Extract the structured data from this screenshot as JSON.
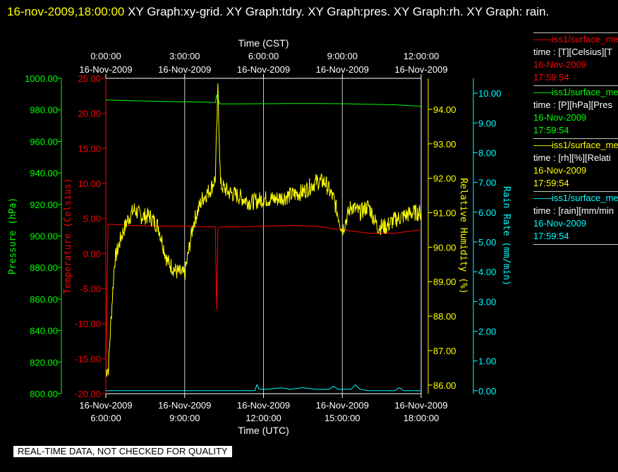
{
  "header": {
    "timestamp": "16-nov-2009,18:00:00",
    "graph_titles": "XY Graph:xy-grid.  XY Graph:tdry.  XY Graph:pres.  XY Graph:rh.  XY Graph: rain."
  },
  "colors": {
    "background": "#000000",
    "pressure": "#00ff00",
    "temperature": "#ff0000",
    "humidity": "#ffff00",
    "rain": "#00ffff",
    "axis": "#ffffff"
  },
  "legend": [
    {
      "series": "——iss1/surface_me",
      "units": "time : [T][Celsius][T",
      "date": "16-Nov-2009",
      "time": "17:59:54",
      "color": "#ff0000"
    },
    {
      "series": "——iss1/surface_me",
      "units": "time : [P][hPa][Pres",
      "date": "16-Nov-2009",
      "time": "17:59:54",
      "color": "#00ff00"
    },
    {
      "series": "——iss1/surface_me",
      "units": "time : [rh][%][Relati",
      "date": "16-Nov-2009",
      "time": "17:59:54",
      "color": "#ffff00"
    },
    {
      "series": "——iss1/surface_me",
      "units": "time : [rain][mm/min",
      "date": "16-Nov-2009",
      "time": "17:59:54",
      "color": "#00ffff"
    }
  ],
  "qc_banner": "REAL-TIME DATA, NOT CHECKED FOR QUALITY",
  "chart_data": {
    "type": "line",
    "grid": "vertical",
    "x_top": {
      "label": "Time (CST)",
      "ticks": [
        {
          "time": "0:00:00",
          "date": "16-Nov-2009"
        },
        {
          "time": "3:00:00",
          "date": "16-Nov-2009"
        },
        {
          "time": "6:00:00",
          "date": "16-Nov-2009"
        },
        {
          "time": "9:00:00",
          "date": "16-Nov-2009"
        },
        {
          "time": "12:00:00",
          "date": "16-Nov-2009"
        }
      ]
    },
    "x_bottom": {
      "label": "Time (UTC)",
      "range": [
        "16-Nov-2009 6:00:00",
        "16-Nov-2009 18:00:00"
      ],
      "ticks": [
        {
          "time": "6:00:00",
          "date": "16-Nov-2009"
        },
        {
          "time": "9:00:00",
          "date": "16-Nov-2009"
        },
        {
          "time": "12:00:00",
          "date": "16-Nov-2009"
        },
        {
          "time": "15:00:00",
          "date": "16-Nov-2009"
        },
        {
          "time": "18:00:00",
          "date": "16-Nov-2009"
        }
      ]
    },
    "axes": {
      "pressure": {
        "label": "Pressure (hPa)",
        "range": [
          800,
          1000
        ],
        "ticks": [
          "800.00",
          "820.00",
          "840.00",
          "860.00",
          "880.00",
          "900.00",
          "920.00",
          "940.00",
          "960.00",
          "980.00",
          "1000.00"
        ]
      },
      "temperature": {
        "label": "Temperature (Celsius)",
        "range": [
          -20,
          25
        ],
        "ticks": [
          "-20.00",
          "-15.00",
          "-10.00",
          "-5.00",
          "0.00",
          "5.00",
          "10.00",
          "15.00",
          "20.00",
          "25.00"
        ]
      },
      "humidity": {
        "label": "Relative Humidity (%)",
        "range": [
          85.75,
          94.9
        ],
        "ticks": [
          "86.00",
          "87.00",
          "88.00",
          "89.00",
          "90.00",
          "91.00",
          "92.00",
          "93.00",
          "94.00"
        ]
      },
      "rain": {
        "label": "Rain Rate (mm/min)",
        "range": [
          -0.1,
          10.5
        ],
        "ticks": [
          "0.00",
          "1.00",
          "2.00",
          "3.00",
          "4.00",
          "5.00",
          "6.00",
          "7.00",
          "8.00",
          "9.00",
          "10.00"
        ]
      }
    },
    "series": [
      {
        "name": "Temperature",
        "axis": "temperature",
        "color": "#ff0000",
        "x": [
          "16-Nov-2009 6:00:00",
          "16-Nov-2009 6:05:00",
          "16-Nov-2009 7:00:00",
          "16-Nov-2009 8:00:00",
          "16-Nov-2009 9:00:00",
          "16-Nov-2009 10:00:00",
          "16-Nov-2009 10:10:00",
          "16-Nov-2009 10:13:00",
          "16-Nov-2009 10:16:00",
          "16-Nov-2009 10:20:00",
          "16-Nov-2009 11:00:00",
          "16-Nov-2009 12:00:00",
          "16-Nov-2009 13:00:00",
          "16-Nov-2009 14:00:00",
          "16-Nov-2009 15:00:00",
          "16-Nov-2009 16:00:00",
          "16-Nov-2009 17:00:00",
          "16-Nov-2009 18:00:00"
        ],
        "y": [
          -18.0,
          4.2,
          4.0,
          3.9,
          3.9,
          3.8,
          3.8,
          -8.0,
          3.5,
          3.8,
          3.8,
          3.9,
          4.0,
          3.9,
          3.4,
          2.9,
          2.9,
          3.4
        ]
      },
      {
        "name": "Pressure",
        "axis": "pressure",
        "color": "#00ff00",
        "x": [
          "16-Nov-2009 6:00:00",
          "16-Nov-2009 7:00:00",
          "16-Nov-2009 8:00:00",
          "16-Nov-2009 9:00:00",
          "16-Nov-2009 10:00:00",
          "16-Nov-2009 10:10:00",
          "16-Nov-2009 10:13:00",
          "16-Nov-2009 10:20:00",
          "16-Nov-2009 11:00:00",
          "16-Nov-2009 12:00:00",
          "16-Nov-2009 13:00:00",
          "16-Nov-2009 14:00:00",
          "16-Nov-2009 15:00:00",
          "16-Nov-2009 16:00:00",
          "16-Nov-2009 17:00:00",
          "16-Nov-2009 18:00:00"
        ],
        "y": [
          986.2,
          985.8,
          985.4,
          985.1,
          984.8,
          984.6,
          989.5,
          983.8,
          983.8,
          983.9,
          984.0,
          984.0,
          983.9,
          983.6,
          983.2,
          982.3
        ]
      },
      {
        "name": "Relative Humidity",
        "axis": "humidity",
        "color": "#ffff00",
        "x": [
          "16-Nov-2009 6:00:00",
          "16-Nov-2009 6:06:00",
          "16-Nov-2009 6:10:00",
          "16-Nov-2009 6:20:00",
          "16-Nov-2009 6:35:00",
          "16-Nov-2009 6:50:00",
          "16-Nov-2009 7:05:00",
          "16-Nov-2009 7:20:00",
          "16-Nov-2009 7:40:00",
          "16-Nov-2009 8:00:00",
          "16-Nov-2009 8:20:00",
          "16-Nov-2009 8:40:00",
          "16-Nov-2009 9:00:00",
          "16-Nov-2009 9:20:00",
          "16-Nov-2009 9:40:00",
          "16-Nov-2009 10:00:00",
          "16-Nov-2009 10:10:00",
          "16-Nov-2009 10:16:00",
          "16-Nov-2009 10:22:00",
          "16-Nov-2009 10:40:00",
          "16-Nov-2009 11:00:00",
          "16-Nov-2009 11:30:00",
          "16-Nov-2009 12:00:00",
          "16-Nov-2009 12:30:00",
          "16-Nov-2009 13:00:00",
          "16-Nov-2009 13:30:00",
          "16-Nov-2009 14:00:00",
          "16-Nov-2009 14:20:00",
          "16-Nov-2009 14:40:00",
          "16-Nov-2009 15:00:00",
          "16-Nov-2009 15:20:00",
          "16-Nov-2009 15:40:00",
          "16-Nov-2009 16:00:00",
          "16-Nov-2009 16:20:00",
          "16-Nov-2009 16:40:00",
          "16-Nov-2009 17:00:00",
          "16-Nov-2009 17:20:00",
          "16-Nov-2009 17:40:00",
          "16-Nov-2009 18:00:00"
        ],
        "y": [
          86.4,
          86.5,
          87.5,
          89.6,
          90.3,
          90.8,
          91.1,
          90.9,
          90.9,
          90.6,
          89.6,
          89.3,
          89.2,
          90.7,
          91.4,
          91.7,
          92.0,
          94.6,
          91.8,
          91.6,
          91.5,
          91.3,
          91.4,
          91.4,
          91.5,
          91.6,
          91.9,
          91.9,
          91.4,
          90.5,
          91.2,
          91.0,
          91.2,
          90.6,
          90.6,
          90.8,
          90.9,
          91.0,
          91.0
        ]
      },
      {
        "name": "Rain Rate",
        "axis": "rain",
        "color": "#00ffff",
        "x": [
          "16-Nov-2009 6:00:00",
          "16-Nov-2009 11:40:00",
          "16-Nov-2009 11:45:00",
          "16-Nov-2009 11:50:00",
          "16-Nov-2009 12:10:00",
          "16-Nov-2009 12:40:00",
          "16-Nov-2009 13:00:00",
          "16-Nov-2009 13:30:00",
          "16-Nov-2009 14:00:00",
          "16-Nov-2009 14:30:00",
          "16-Nov-2009 14:40:00",
          "16-Nov-2009 14:50:00",
          "16-Nov-2009 15:00:00",
          "16-Nov-2009 15:20:00",
          "16-Nov-2009 15:30:00",
          "16-Nov-2009 15:40:00",
          "16-Nov-2009 16:00:00",
          "16-Nov-2009 16:30:00",
          "16-Nov-2009 17:00:00",
          "16-Nov-2009 17:10:00",
          "16-Nov-2009 17:20:00",
          "16-Nov-2009 18:00:00"
        ],
        "y": [
          0.0,
          0.0,
          0.2,
          0.05,
          0.05,
          0.1,
          0.05,
          0.1,
          0.05,
          0.05,
          0.15,
          0.05,
          0.05,
          0.05,
          0.2,
          0.05,
          0.0,
          0.0,
          0.0,
          0.1,
          0.0,
          0.0
        ]
      }
    ]
  }
}
